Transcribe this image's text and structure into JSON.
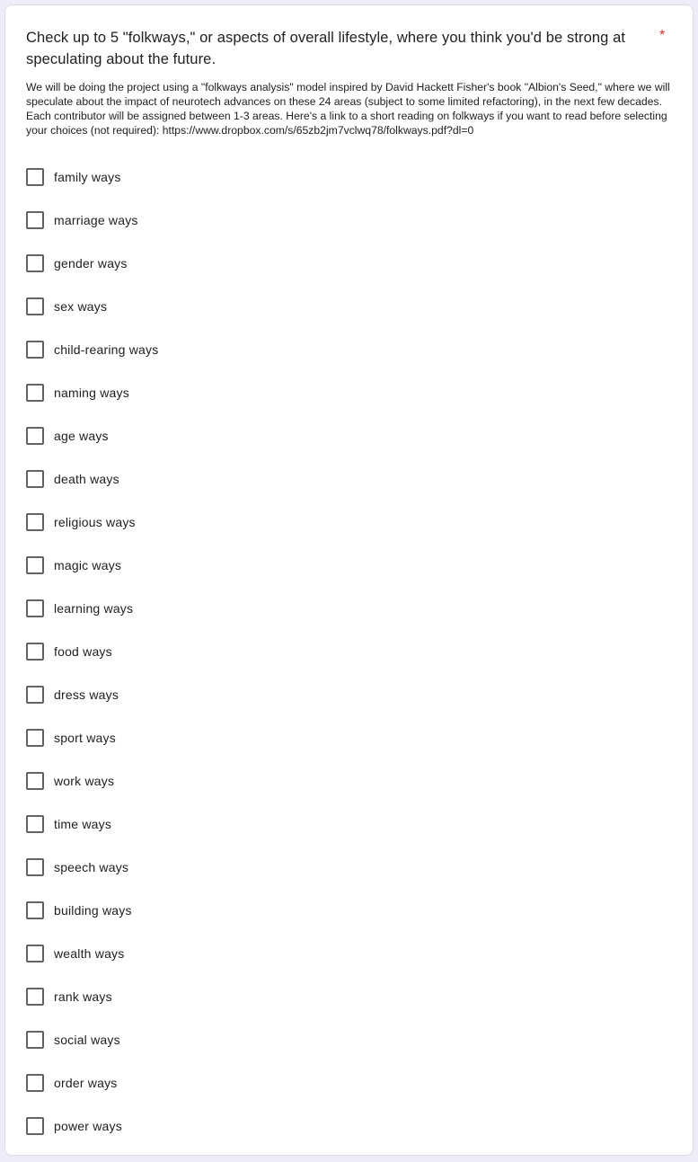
{
  "question": {
    "title": "Check up to 5 \"folkways,\" or aspects of overall lifestyle, where you think you'd be strong at speculating about the future.",
    "required_marker": "*",
    "description": "We will be doing the project using a \"folkways analysis\" model inspired by David Hackett Fisher's book \"Albion's Seed,\" where we will speculate about the impact of neurotech advances on these 24 areas (subject to some limited refactoring), in the next few decades. Each contributor will be assigned between 1-3 areas. Here's a link to a short reading on folkways if you want to read before selecting your choices (not required): https://www.dropbox.com/s/65zb2jm7vclwq78/folkways.pdf?dl=0",
    "options": [
      {
        "label": "family ways",
        "checked": false
      },
      {
        "label": "marriage ways",
        "checked": false
      },
      {
        "label": "gender ways",
        "checked": false
      },
      {
        "label": "sex ways",
        "checked": false
      },
      {
        "label": "child-rearing ways",
        "checked": false
      },
      {
        "label": "naming ways",
        "checked": false
      },
      {
        "label": "age ways",
        "checked": false
      },
      {
        "label": "death ways",
        "checked": false
      },
      {
        "label": "religious ways",
        "checked": false
      },
      {
        "label": "magic ways",
        "checked": false
      },
      {
        "label": "learning ways",
        "checked": false
      },
      {
        "label": "food ways",
        "checked": false
      },
      {
        "label": "dress ways",
        "checked": false
      },
      {
        "label": "sport ways",
        "checked": false
      },
      {
        "label": "work ways",
        "checked": false
      },
      {
        "label": "time ways",
        "checked": false
      },
      {
        "label": "speech ways",
        "checked": false
      },
      {
        "label": "building ways",
        "checked": false
      },
      {
        "label": "wealth ways",
        "checked": false
      },
      {
        "label": "rank ways",
        "checked": false
      },
      {
        "label": "social ways",
        "checked": false
      },
      {
        "label": "order ways",
        "checked": false
      },
      {
        "label": "power ways",
        "checked": false
      }
    ]
  },
  "colors": {
    "required": "#d93025",
    "checkbox_border": "#5f6368",
    "text": "#202124",
    "card_border": "#dadce0"
  }
}
